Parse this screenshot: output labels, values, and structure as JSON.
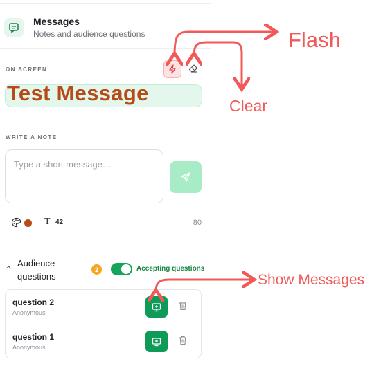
{
  "header": {
    "title": "Messages",
    "subtitle": "Notes and audience questions",
    "icon": "message-icon"
  },
  "on_screen": {
    "label": "ON SCREEN",
    "message": "Test Message",
    "flash_icon": "lightning-icon",
    "clear_icon": "eraser-icon"
  },
  "note": {
    "label": "WRITE A NOTE",
    "placeholder": "Type a short message…",
    "value": "",
    "send_icon": "send-icon",
    "color_hex": "#b74a16",
    "font_size": "42",
    "char_remaining": "80"
  },
  "audience": {
    "title": "Audience questions",
    "count": "2",
    "accepting_label": "Accepting questions",
    "accepting": true,
    "questions": [
      {
        "title": "question 2",
        "author": "Anonymous"
      },
      {
        "title": "question 1",
        "author": "Anonymous"
      }
    ]
  },
  "annotations": {
    "flash": "Flash",
    "clear": "Clear",
    "show": "Show Messages",
    "color_hex": "#f25a5a"
  },
  "colors": {
    "accent_green": "#16a35b",
    "message_brown": "#b74a16",
    "badge_orange": "#f5a623"
  }
}
